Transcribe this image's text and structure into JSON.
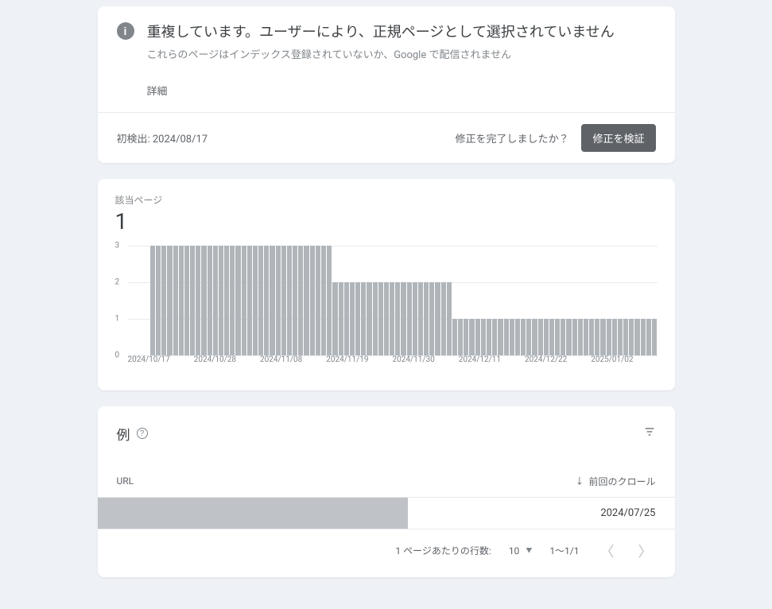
{
  "info": {
    "title": "重複しています。ユーザーにより、正規ページとして選択されていません",
    "subtitle": "これらのページはインデックス登録されていないか、Google で配信されません",
    "detail_link": "詳細",
    "first_detected_label": "初検出: 2024/08/17",
    "fix_question": "修正を完了しましたか？",
    "validate_button": "修正を検証"
  },
  "chart_data": {
    "type": "bar",
    "label": "該当ページ",
    "current_value": "1",
    "y_ticks": [
      0,
      1,
      2,
      3
    ],
    "ylim": [
      0,
      3
    ],
    "x_labels": [
      "2024/10/17",
      "2024/10/28",
      "2024/11/08",
      "2024/11/19",
      "2024/11/30",
      "2024/12/11",
      "2024/12/22",
      "2025/01/02"
    ],
    "values": [
      0,
      0,
      3,
      3,
      3,
      3,
      3,
      3,
      3,
      3,
      3,
      3,
      3,
      3,
      3,
      3,
      3,
      3,
      3,
      3,
      3,
      3,
      3,
      3,
      3,
      3,
      3,
      3,
      3,
      3,
      3,
      3,
      3,
      3,
      2,
      2,
      2,
      2,
      2,
      2,
      2,
      2,
      2,
      2,
      2,
      2,
      2,
      2,
      2,
      2,
      2,
      2,
      2,
      2,
      2,
      1,
      1,
      1,
      1,
      1,
      1,
      1,
      1,
      1,
      1,
      1,
      1,
      1,
      1,
      1,
      1,
      1,
      1,
      1,
      1,
      1,
      1,
      1,
      1,
      1,
      1,
      1,
      1,
      1,
      1,
      1,
      1,
      1,
      1,
      1,
      1
    ]
  },
  "examples": {
    "title": "例",
    "col_url": "URL",
    "col_crawl": "前回のクロール",
    "rows": [
      {
        "url": "",
        "last_crawl": "2024/07/25"
      }
    ],
    "pager": {
      "rows_per_page_label": "1 ページあたりの行数:",
      "rows_per_page_value": "10",
      "range": "1～1/1"
    }
  }
}
